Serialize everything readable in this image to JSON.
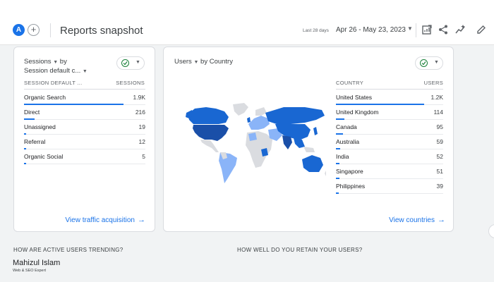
{
  "header": {
    "avatar_letter": "A",
    "add_symbol": "+",
    "title": "Reports snapshot",
    "range_label": "Last 28 days",
    "date_range": "Apr 26 - May 23, 2023",
    "icons": [
      "customize-report-icon",
      "share-icon",
      "insights-icon",
      "edit-icon"
    ]
  },
  "sessions_card": {
    "metric": "Sessions",
    "by": "by",
    "dimension": "Session default c...",
    "col_dimension": "SESSION DEFAULT ...",
    "col_metric": "SESSIONS",
    "rows": [
      {
        "label": "Organic Search",
        "value": "1.9K",
        "share": 0.82
      },
      {
        "label": "Direct",
        "value": "216",
        "share": 0.09
      },
      {
        "label": "Unassigned",
        "value": "19",
        "share": 0.008
      },
      {
        "label": "Referral",
        "value": "12",
        "share": 0.005
      },
      {
        "label": "Organic Social",
        "value": "5",
        "share": 0.002
      }
    ],
    "link": "View traffic acquisition"
  },
  "country_card": {
    "metric": "Users",
    "by": "by Country",
    "col_dimension": "COUNTRY",
    "col_metric": "USERS",
    "rows": [
      {
        "label": "United States",
        "value": "1.2K",
        "share": 0.82
      },
      {
        "label": "United Kingdom",
        "value": "114",
        "share": 0.08
      },
      {
        "label": "Canada",
        "value": "95",
        "share": 0.065
      },
      {
        "label": "Australia",
        "value": "59",
        "share": 0.04
      },
      {
        "label": "India",
        "value": "52",
        "share": 0.035
      },
      {
        "label": "Singapore",
        "value": "51",
        "share": 0.035
      },
      {
        "label": "Philippines",
        "value": "39",
        "share": 0.027
      }
    ],
    "link": "View countries"
  },
  "sections": {
    "active_users": "HOW ARE ACTIVE USERS TRENDING?",
    "retention": "HOW WELL DO YOU RETAIN YOUR USERS?"
  },
  "watermark": {
    "name": "Mahizul Islam",
    "subtitle": "Web & SEO Expert"
  },
  "colors": {
    "accent": "#1a73e8",
    "map_dark": "#1967d2",
    "map_light": "#8ab4f8",
    "map_none": "#dadce0",
    "check_green": "#188038"
  }
}
